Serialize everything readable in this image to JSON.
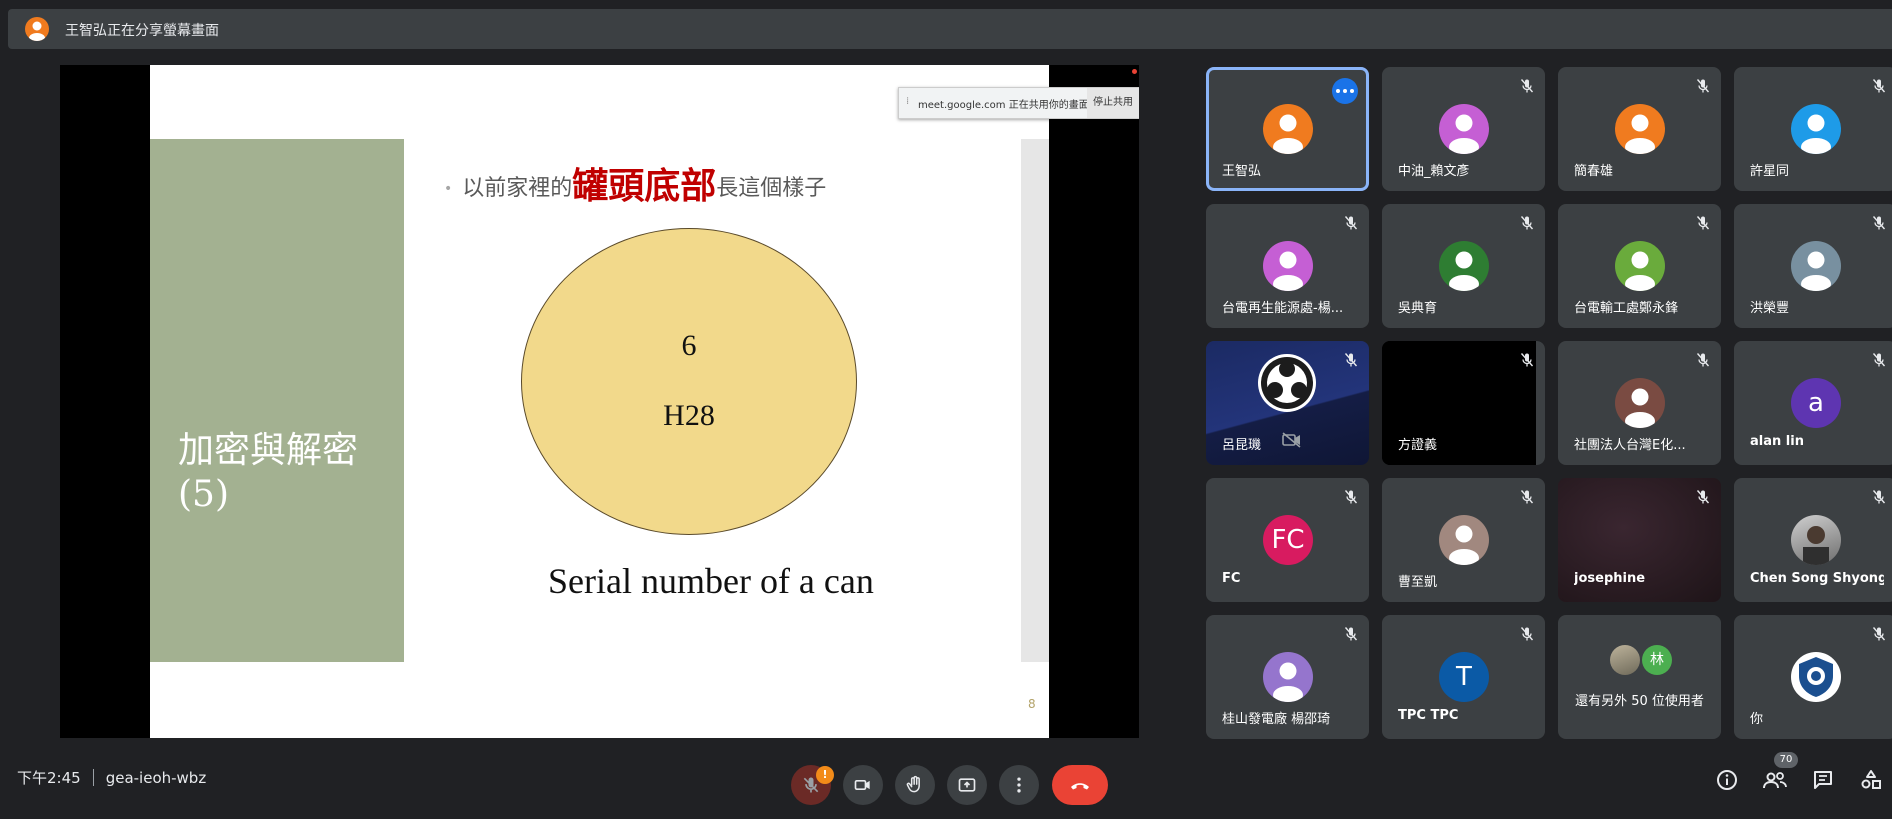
{
  "banner": {
    "text": "王智弘正在分享螢幕畫面"
  },
  "slide": {
    "title": "加密與解密\n(5)",
    "bullet_prefix": "以前家裡的",
    "bullet_highlight": "罐頭底部",
    "bullet_suffix": "長這個樣子",
    "can_line1": "6",
    "can_line2": "H28",
    "caption": "Serial number of a can",
    "page_number": "8"
  },
  "sharebar": {
    "message": "meet.google.com 正在共用你的畫面。",
    "stop_label": "停止共用"
  },
  "participants": [
    {
      "name": "王智弘",
      "color": "#f07b1f",
      "type": "person",
      "active": true,
      "muted": false
    },
    {
      "name": "中油_賴文彥",
      "color": "#c55fd4",
      "type": "person",
      "muted": true
    },
    {
      "name": "簡春雄",
      "color": "#f07b1f",
      "type": "person",
      "muted": true
    },
    {
      "name": "許星同",
      "color": "#1e9be8",
      "type": "person",
      "muted": true
    },
    {
      "name": "台電再生能源處-楊...",
      "color": "#c55fd4",
      "type": "person",
      "muted": true
    },
    {
      "name": "吳典育",
      "color": "#2e7d32",
      "type": "person",
      "muted": true
    },
    {
      "name": "台電輸工處鄭永鋒",
      "color": "#6aab3c",
      "type": "person",
      "muted": true
    },
    {
      "name": "洪榮豐",
      "color": "#7890a0",
      "type": "person",
      "muted": true
    },
    {
      "name": "呂昆璣",
      "color": "#1c2a5e",
      "type": "obs",
      "muted": true
    },
    {
      "name": "方證義",
      "color": "#000000",
      "type": "video",
      "muted": true
    },
    {
      "name": "社團法人台灣E化...",
      "color": "#7a4b42",
      "type": "person",
      "muted": true
    },
    {
      "name": "alan lin",
      "color": "#5e35b1",
      "type": "letter",
      "letter": "a",
      "bold": true,
      "muted": true
    },
    {
      "name": "FC",
      "color": "#d81b60",
      "type": "letter",
      "letter": "FC",
      "bold": true,
      "muted": true
    },
    {
      "name": "曹至凱",
      "color": "#a1887f",
      "type": "person",
      "muted": true
    },
    {
      "name": "josephine",
      "color": "#2a1a20",
      "type": "video",
      "bold": true,
      "muted": true
    },
    {
      "name": "Chen Song Shyong",
      "color": "#9e9e9e",
      "type": "photo",
      "bold": true,
      "muted": true
    },
    {
      "name": "桂山發電廠 楊邵琦",
      "color": "#9575cd",
      "type": "person",
      "muted": true
    },
    {
      "name": "TPC TPC",
      "color": "#0b5aa6",
      "type": "letter",
      "letter": "T",
      "bold": true,
      "muted": true
    },
    {
      "name": "還有另外 50 位使用者",
      "type": "overflow",
      "overflow_letter": "林",
      "muted": false
    },
    {
      "name": "你",
      "color": "#ffffff",
      "type": "logo",
      "muted": true
    }
  ],
  "bottom": {
    "time": "下午2:45",
    "meeting_code": "gea-ieoh-wbz",
    "mic_alert": "!",
    "participant_count": "70"
  },
  "colors": {
    "background": "#202124",
    "tile": "#3c4043",
    "accent": "#8ab4f8",
    "hangup": "#ea4335"
  }
}
